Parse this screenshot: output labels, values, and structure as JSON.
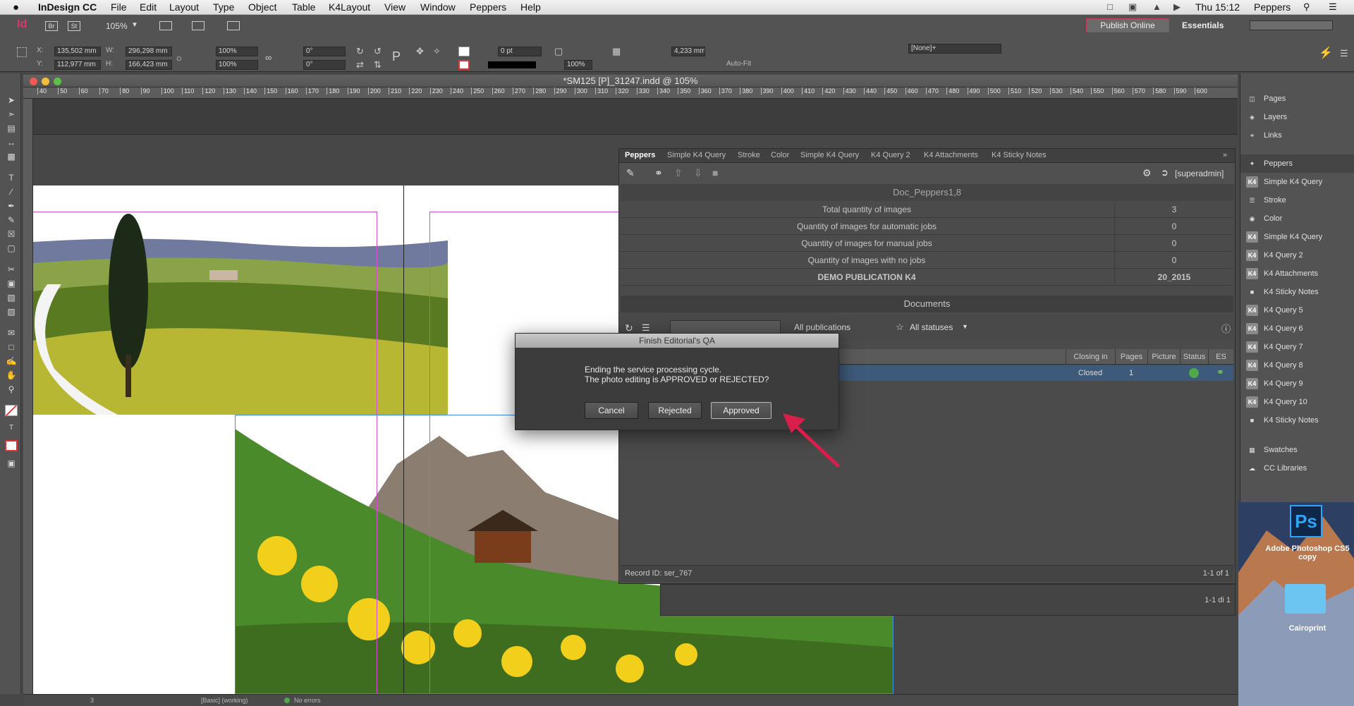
{
  "menubar": {
    "apple": "",
    "app_name": "InDesign CC",
    "items": [
      "File",
      "Edit",
      "Layout",
      "Type",
      "Object",
      "Table",
      "K4Layout",
      "View",
      "Window",
      "Peppers",
      "Help"
    ],
    "clock": "Thu 15:12",
    "user": "Peppers"
  },
  "appbar": {
    "logo": "Id",
    "br": "Br",
    "st": "St",
    "zoom": "105%",
    "publish_online": "Publish Online",
    "workspace": "Essentials"
  },
  "control": {
    "x_label": "X:",
    "x_value": "135,502 mm",
    "y_label": "Y:",
    "y_value": "112,977 mm",
    "w_label": "W:",
    "w_value": "296,298 mm",
    "h_label": "H:",
    "h_value": "166,423 mm",
    "scale_x": "100%",
    "scale_y": "100%",
    "rotate": "0°",
    "shear": "0°",
    "stroke_weight": "0 pt",
    "opacity": "100%",
    "offset": "4,233 mm",
    "autofit": "Auto-Fit",
    "object_style": "[None]+"
  },
  "document": {
    "title": "*SM125 [P]_31247.indd @ 105%",
    "ruler_ticks": [
      "40",
      "50",
      "60",
      "70",
      "80",
      "90",
      "100",
      "110",
      "120",
      "130",
      "140",
      "150",
      "160",
      "170",
      "180",
      "190",
      "200",
      "210",
      "220",
      "230",
      "240",
      "250",
      "260",
      "270",
      "280",
      "290",
      "300",
      "310",
      "320",
      "330",
      "340",
      "350",
      "360",
      "370",
      "380",
      "390",
      "400",
      "410",
      "420",
      "430",
      "440",
      "450",
      "460",
      "470",
      "480",
      "490",
      "500",
      "510",
      "520",
      "530",
      "540",
      "550",
      "560",
      "570",
      "580",
      "590",
      "600"
    ]
  },
  "right_panel": {
    "groups": [
      [
        "Pages",
        "Layers",
        "Links"
      ],
      [
        "Peppers",
        "Simple K4 Query",
        "Stroke",
        "Color",
        "Simple K4 Query",
        "K4 Query  2",
        "K4 Attachments",
        "K4 Sticky Notes",
        "K4 Query  5",
        "K4 Query  6",
        "K4 Query  7",
        "K4 Query  8",
        "K4 Query  9",
        "K4 Query 10",
        "K4 Sticky Notes"
      ],
      [
        "Swatches",
        "CC Libraries"
      ]
    ]
  },
  "peppers_panel": {
    "tabs": [
      "Peppers",
      "Simple K4 Query",
      "Stroke",
      "Color",
      "Simple K4 Query",
      "K4 Query  2",
      "K4 Attachments",
      "K4 Sticky Notes"
    ],
    "user": "[superadmin]",
    "doc_name": "Doc_Peppers1,8",
    "stats": [
      {
        "label": "Total quantity of images",
        "value": "3"
      },
      {
        "label": "Quantity of images for automatic jobs",
        "value": "0"
      },
      {
        "label": "Quantity of images for manual jobs",
        "value": "0"
      },
      {
        "label": "Quantity of images with no jobs",
        "value": "0"
      },
      {
        "label": "DEMO PUBLICATION K4",
        "value": "20_2015"
      }
    ],
    "documents_header": "Documents",
    "filter_publication": "All publications",
    "filter_statuses": "All statuses",
    "columns": [
      "Closing in",
      "Pages",
      "Picture",
      "Status",
      "ES"
    ],
    "row": {
      "closing": "Closed",
      "pages": "1"
    },
    "record_id": "Record ID: ser_767",
    "count1": "1-1 of 1",
    "count2": "1-1 di 1"
  },
  "dialog": {
    "title": "Finish Editorial's QA",
    "line1": "Ending the service processing cycle.",
    "line2": "The photo editing is APPROVED or REJECTED?",
    "cancel": "Cancel",
    "rejected": "Rejected",
    "approved": "Approved"
  },
  "statusbar": {
    "page": "3",
    "mode": "[Basic] (working)",
    "errors": "No errors"
  },
  "desktop": {
    "ps_label": "Ps",
    "item1": "Adobe Photoshop CS5 copy",
    "item2": "Cairoprint"
  },
  "colors": {
    "accent_arrow": "#d81e4a",
    "status_green": "#4fa84a",
    "selected_row": "#3e5a7a"
  }
}
